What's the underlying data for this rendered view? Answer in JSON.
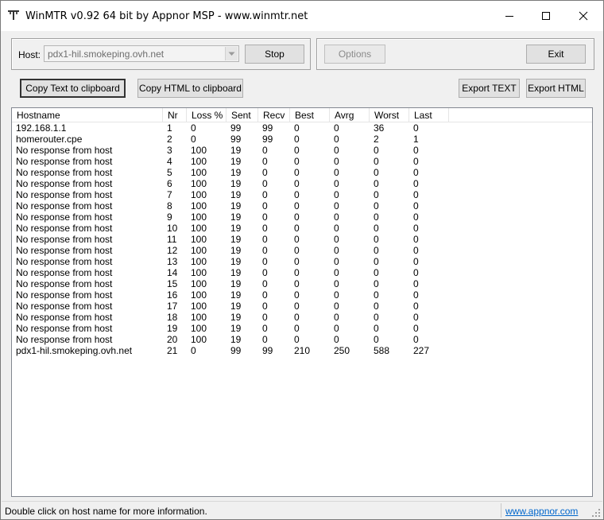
{
  "window": {
    "title": "WinMTR v0.92 64 bit by Appnor MSP - www.winmtr.net"
  },
  "host": {
    "label": "Host:",
    "value": "pdx1-hil.smokeping.ovh.net"
  },
  "buttons": {
    "stop": "Stop",
    "options": "Options",
    "exit": "Exit",
    "copy_text": "Copy Text to clipboard",
    "copy_html": "Copy HTML to clipboard",
    "export_text": "Export TEXT",
    "export_html": "Export HTML"
  },
  "table": {
    "columns": [
      "Hostname",
      "Nr",
      "Loss %",
      "Sent",
      "Recv",
      "Best",
      "Avrg",
      "Worst",
      "Last"
    ],
    "rows": [
      [
        "192.168.1.1",
        "1",
        "0",
        "99",
        "99",
        "0",
        "0",
        "36",
        "0"
      ],
      [
        "homerouter.cpe",
        "2",
        "0",
        "99",
        "99",
        "0",
        "0",
        "2",
        "1"
      ],
      [
        "No response from host",
        "3",
        "100",
        "19",
        "0",
        "0",
        "0",
        "0",
        "0"
      ],
      [
        "No response from host",
        "4",
        "100",
        "19",
        "0",
        "0",
        "0",
        "0",
        "0"
      ],
      [
        "No response from host",
        "5",
        "100",
        "19",
        "0",
        "0",
        "0",
        "0",
        "0"
      ],
      [
        "No response from host",
        "6",
        "100",
        "19",
        "0",
        "0",
        "0",
        "0",
        "0"
      ],
      [
        "No response from host",
        "7",
        "100",
        "19",
        "0",
        "0",
        "0",
        "0",
        "0"
      ],
      [
        "No response from host",
        "8",
        "100",
        "19",
        "0",
        "0",
        "0",
        "0",
        "0"
      ],
      [
        "No response from host",
        "9",
        "100",
        "19",
        "0",
        "0",
        "0",
        "0",
        "0"
      ],
      [
        "No response from host",
        "10",
        "100",
        "19",
        "0",
        "0",
        "0",
        "0",
        "0"
      ],
      [
        "No response from host",
        "11",
        "100",
        "19",
        "0",
        "0",
        "0",
        "0",
        "0"
      ],
      [
        "No response from host",
        "12",
        "100",
        "19",
        "0",
        "0",
        "0",
        "0",
        "0"
      ],
      [
        "No response from host",
        "13",
        "100",
        "19",
        "0",
        "0",
        "0",
        "0",
        "0"
      ],
      [
        "No response from host",
        "14",
        "100",
        "19",
        "0",
        "0",
        "0",
        "0",
        "0"
      ],
      [
        "No response from host",
        "15",
        "100",
        "19",
        "0",
        "0",
        "0",
        "0",
        "0"
      ],
      [
        "No response from host",
        "16",
        "100",
        "19",
        "0",
        "0",
        "0",
        "0",
        "0"
      ],
      [
        "No response from host",
        "17",
        "100",
        "19",
        "0",
        "0",
        "0",
        "0",
        "0"
      ],
      [
        "No response from host",
        "18",
        "100",
        "19",
        "0",
        "0",
        "0",
        "0",
        "0"
      ],
      [
        "No response from host",
        "19",
        "100",
        "19",
        "0",
        "0",
        "0",
        "0",
        "0"
      ],
      [
        "No response from host",
        "20",
        "100",
        "19",
        "0",
        "0",
        "0",
        "0",
        "0"
      ],
      [
        "pdx1-hil.smokeping.ovh.net",
        "21",
        "0",
        "99",
        "99",
        "210",
        "250",
        "588",
        "227"
      ]
    ]
  },
  "status": {
    "text": "Double click on host name for more information.",
    "link": "www.appnor.com"
  },
  "icons": {
    "app": "winmtr-app-icon",
    "minimize": "minimize-icon",
    "maximize": "maximize-icon",
    "close": "close-icon",
    "dropdown": "chevron-down-icon",
    "grip": "resize-grip-icon"
  },
  "colors": {
    "window_bg": "#f0f0f0",
    "link": "#0066cc",
    "default_button_border": "#0078d7"
  }
}
